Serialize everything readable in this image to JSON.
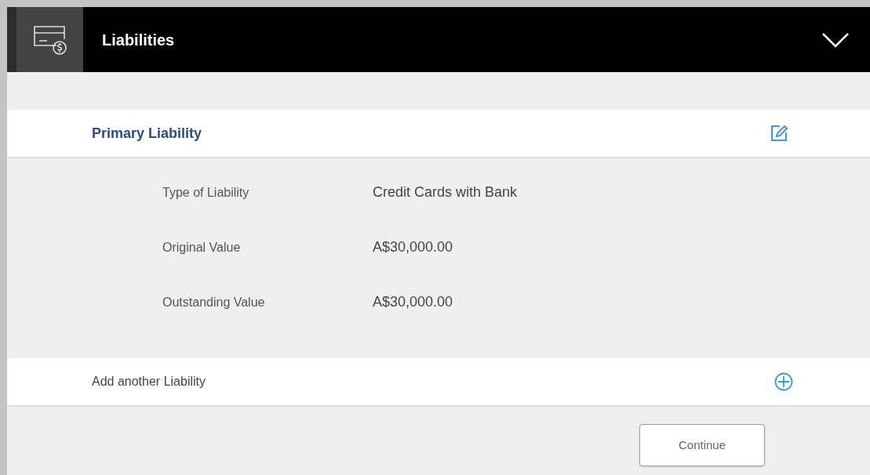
{
  "header": {
    "title": "Liabilities"
  },
  "liability": {
    "title": "Primary Liability",
    "fields": [
      {
        "label": "Type of Liability",
        "value": "Credit Cards with Bank"
      },
      {
        "label": "Original Value",
        "value": "A$30,000.00"
      },
      {
        "label": "Outstanding Value",
        "value": "A$30,000.00"
      }
    ]
  },
  "add_row": {
    "label": "Add another Liability"
  },
  "buttons": [
    "Continue"
  ]
}
